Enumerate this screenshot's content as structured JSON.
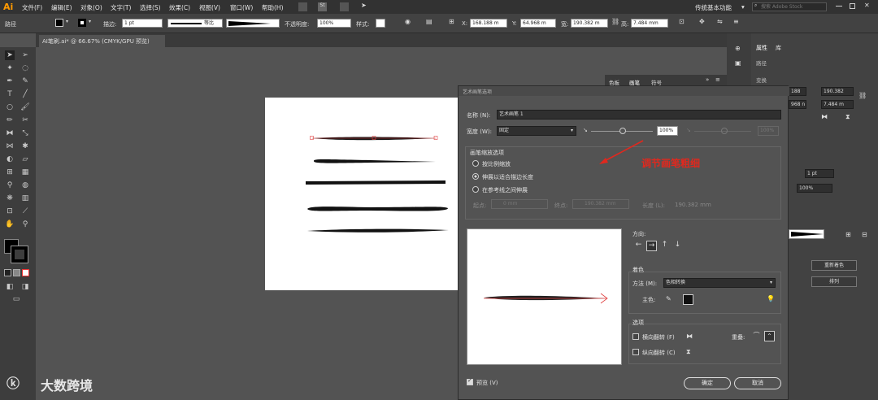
{
  "app": {
    "logo": "Ai",
    "menu": [
      "文件(F)",
      "编辑(E)",
      "对象(O)",
      "文字(T)",
      "选择(S)",
      "效果(C)",
      "视图(V)",
      "窗口(W)",
      "帮助(H)"
    ],
    "workspace": "传统基本功能",
    "search_placeholder": "搜索 Adobe Stock"
  },
  "control": {
    "path_label": "路径",
    "stroke_label": "描边:",
    "stroke_value": "1 pt",
    "stroke_type": "等比",
    "opacity_label": "不透明度:",
    "opacity_value": "100%",
    "style_label": "样式:",
    "x_value": "168.188 m",
    "y_value": "64.968 m",
    "w_value": "190.382 m",
    "h_value": "7.484 mm"
  },
  "document": {
    "tab": "AI笔刷.ai* @ 66.67% (CMYK/GPU 预览)"
  },
  "panels": {
    "brush_tabs": [
      "色板",
      "画笔",
      "符号"
    ],
    "right_tabs": [
      "属性",
      "库"
    ],
    "path": "路径",
    "transform": "变换",
    "r1": "188",
    "r2": "968 n",
    "r3": "190.382",
    "r4": "7.484 m",
    "stroke_pt": "1 pt",
    "opacity": "100%",
    "btn1": "重新着色",
    "btn2": "排列"
  },
  "dialog": {
    "title": "艺术画笔选项",
    "name_label": "名称 (N):",
    "name_value": "艺术画笔 1",
    "width_label": "宽度 (W):",
    "width_mode": "固定",
    "width_pct": "100%",
    "width_pct2": "100%",
    "scale_title": "画笔缩放选项",
    "opt_proportional": "按比例缩放",
    "opt_stretch": "伸展以适合描边长度",
    "opt_guides": "在参考线之间伸展",
    "start_label": "起点:",
    "start_value": "0 mm",
    "end_label": "终点:",
    "end_value": "190.382 mm",
    "length_label": "长度 (L):",
    "length_value": "190.382 mm",
    "direction_label": "方向:",
    "colorize_title": "着色",
    "method_label": "方法 (M):",
    "method_value": "色相转换",
    "key_color_label": "主色:",
    "options_title": "选项",
    "flip_along": "横向翻转 (F)",
    "flip_across": "纵向翻转 (C)",
    "overlap_label": "重叠:",
    "preview_label": "预览 (V)",
    "ok_label": "确定",
    "cancel_label": "取消"
  },
  "annotation": "调节画笔粗细",
  "watermark": "大数跨境",
  "colors": {
    "accent": "#ff9a00",
    "annotation": "#e0281e"
  }
}
